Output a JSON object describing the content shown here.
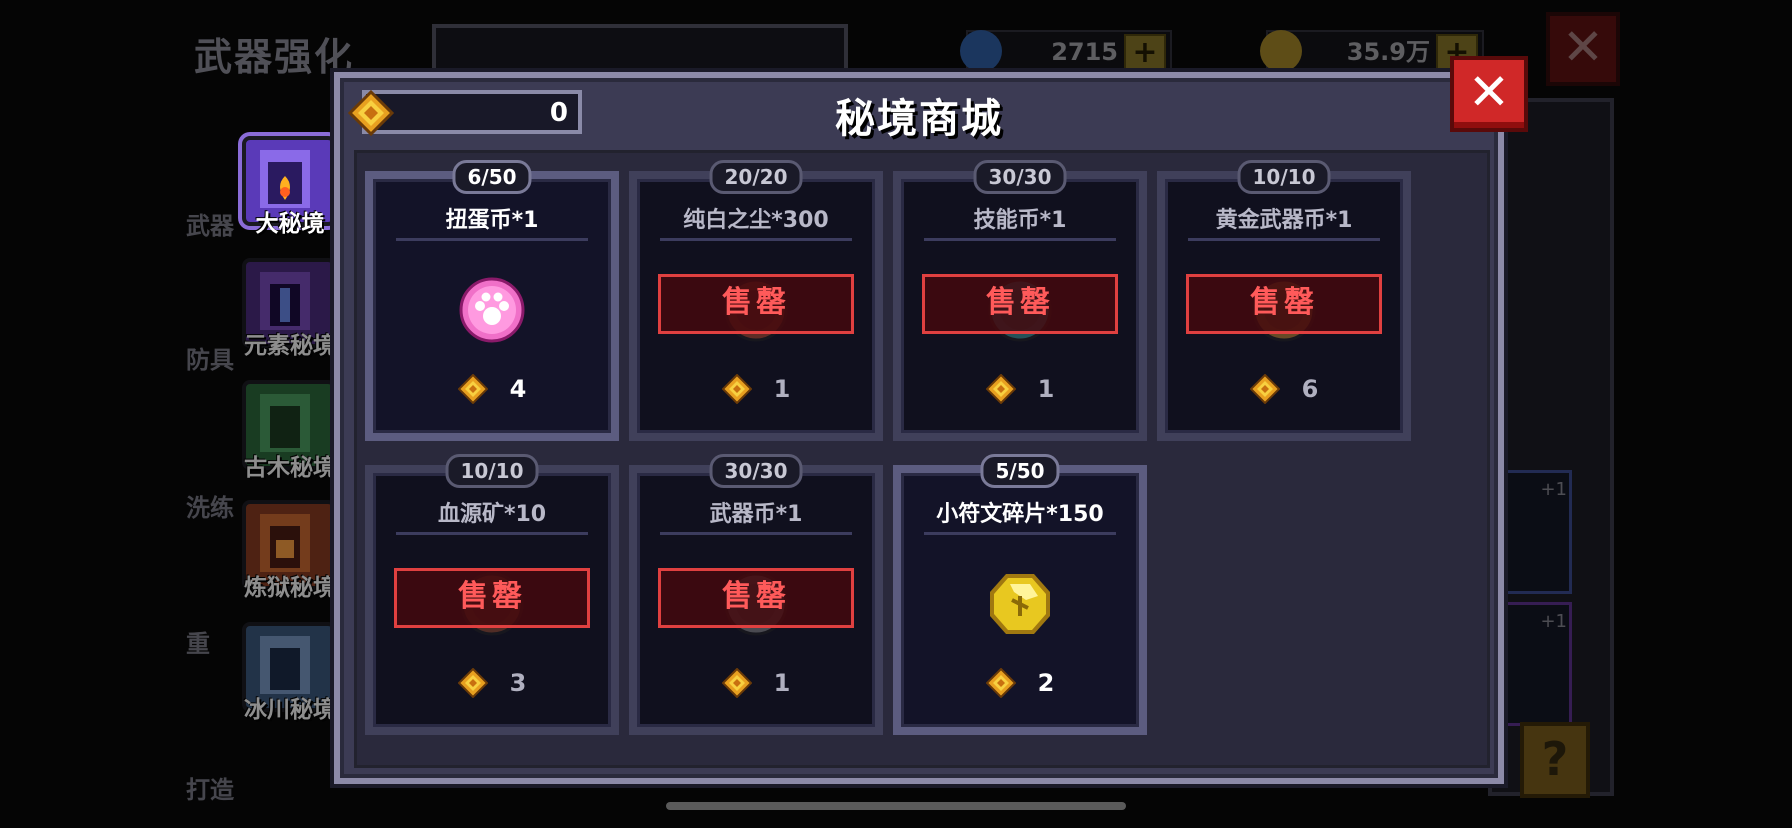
{
  "background": {
    "title": "武器强化",
    "resources": [
      {
        "value": "2715",
        "icon": "gem-icon",
        "color": "#3a7ad8"
      },
      {
        "value": "35.9万",
        "icon": "gold-coin-icon",
        "color": "#d8b030"
      }
    ],
    "side_labels": [
      "武器",
      "防具",
      "洗练",
      "重",
      "打造"
    ],
    "plus_labels": [
      "+1",
      "+1"
    ],
    "help": "?",
    "close": "✕"
  },
  "tabs": [
    {
      "label": "大秘境",
      "color": "#7a5ad8",
      "active": true
    },
    {
      "label": "元素秘境",
      "color": "#6a3ab0",
      "active": false
    },
    {
      "label": "古木秘境",
      "color": "#3a9a5a",
      "active": false
    },
    {
      "label": "炼狱秘境",
      "color": "#c06030",
      "active": false
    },
    {
      "label": "冰川秘境",
      "color": "#6a8ab8",
      "active": false
    }
  ],
  "shop": {
    "title": "秘境商城",
    "currency_value": "0",
    "currency_icon": "rune-gem-icon",
    "close_label": "✕",
    "sold_out_label": "售罄",
    "items": [
      {
        "count": "6/50",
        "name": "扭蛋币*1",
        "price": "4",
        "sold_out": false,
        "icon": "paw-coin-icon",
        "icon_color": "#f070c8"
      },
      {
        "count": "20/20",
        "name": "纯白之尘*300",
        "price": "1",
        "sold_out": true,
        "icon": "dust-icon",
        "icon_color": "#c05030"
      },
      {
        "count": "30/30",
        "name": "技能币*1",
        "price": "1",
        "sold_out": true,
        "icon": "skill-coin-icon",
        "icon_color": "#40a0a0"
      },
      {
        "count": "10/10",
        "name": "黄金武器币*1",
        "price": "6",
        "sold_out": true,
        "icon": "gold-weapon-coin-icon",
        "icon_color": "#d09030"
      },
      {
        "count": "10/10",
        "name": "血源矿*10",
        "price": "3",
        "sold_out": true,
        "icon": "blood-ore-icon",
        "icon_color": "#a05030"
      },
      {
        "count": "30/30",
        "name": "武器币*1",
        "price": "1",
        "sold_out": true,
        "icon": "weapon-coin-icon",
        "icon_color": "#909090"
      },
      {
        "count": "5/50",
        "name": "小符文碎片*150",
        "price": "2",
        "sold_out": false,
        "icon": "rune-fragment-icon",
        "icon_color": "#e8c820"
      }
    ]
  }
}
